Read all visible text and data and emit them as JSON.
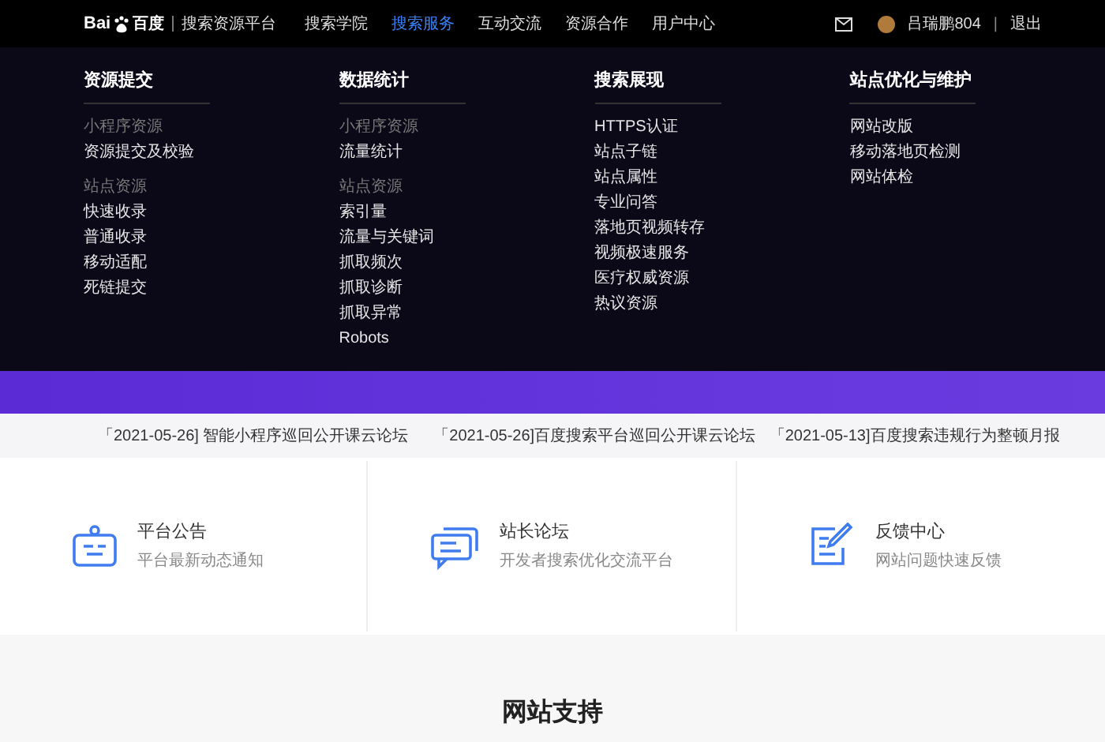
{
  "nav": {
    "logo_left": "Bai",
    "logo_right": "百度",
    "platform": "搜索资源平台",
    "items": [
      {
        "label": "搜索学院",
        "selected": false
      },
      {
        "label": "搜索服务",
        "selected": true
      },
      {
        "label": "互动交流",
        "selected": false
      },
      {
        "label": "资源合作",
        "selected": false
      },
      {
        "label": "用户中心",
        "selected": false
      }
    ],
    "user": {
      "name": "吕瑞鹏804",
      "separator": "|",
      "logout": "退出"
    }
  },
  "menu": [
    {
      "title": "资源提交",
      "groups": [
        {
          "label": "小程序资源",
          "items": [
            "资源提交及校验"
          ]
        },
        {
          "label": "站点资源",
          "items": [
            "快速收录",
            "普通收录",
            "移动适配",
            "死链提交"
          ]
        }
      ]
    },
    {
      "title": "数据统计",
      "groups": [
        {
          "label": "小程序资源",
          "items": [
            "流量统计"
          ]
        },
        {
          "label": "站点资源",
          "items": [
            "索引量",
            "流量与关键词",
            "抓取频次",
            "抓取诊断",
            "抓取异常",
            "Robots"
          ]
        }
      ]
    },
    {
      "title": "搜索展现",
      "groups": [
        {
          "items": [
            "HTTPS认证",
            "站点子链",
            "站点属性",
            "专业问答",
            "落地页视频转存",
            "视频极速服务",
            "医疗权威资源",
            "热议资源"
          ]
        }
      ]
    },
    {
      "title": "站点优化与维护",
      "groups": [
        {
          "items": [
            "网站改版",
            "移动落地页检测",
            "网站体检"
          ]
        }
      ]
    }
  ],
  "news": [
    "「2021-05-26] 智能小程序巡回公开课云论坛",
    "「2021-05-26]百度搜索平台巡回公开课云论坛",
    "「2021-05-13]百度搜索违规行为整顿月报"
  ],
  "cards": [
    {
      "kind": "notice",
      "title": "平台公告",
      "desc": "平台最新动态通知"
    },
    {
      "kind": "forum",
      "title": "站长论坛",
      "desc": "开发者搜索优化交流平台"
    },
    {
      "kind": "feedback",
      "title": "反馈中心",
      "desc": "网站问题快速反馈"
    }
  ],
  "section": {
    "title": "网站支持"
  }
}
